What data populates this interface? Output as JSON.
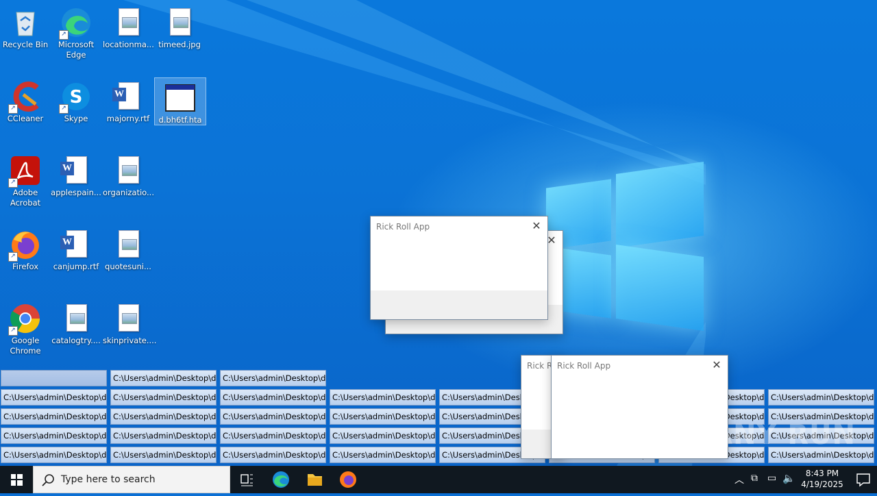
{
  "desktop": {
    "icons": [
      {
        "label": "Recycle Bin",
        "icon": "recycle-bin-icon"
      },
      {
        "label": "Microsoft Edge",
        "icon": "edge-icon"
      },
      {
        "label": "locationma...",
        "icon": "image-file-icon"
      },
      {
        "label": "timeed.jpg",
        "icon": "image-file-icon"
      },
      {
        "label": "CCleaner",
        "icon": "ccleaner-icon"
      },
      {
        "label": "Skype",
        "icon": "skype-icon"
      },
      {
        "label": "majorny.rtf",
        "icon": "word-doc-icon"
      },
      {
        "label": "d.bh6tf.hta",
        "icon": "hta-window-icon"
      },
      {
        "label": "Adobe Acrobat",
        "icon": "acrobat-icon"
      },
      {
        "label": "applespain...",
        "icon": "word-doc-icon"
      },
      {
        "label": "organizatio...",
        "icon": "image-file-icon"
      },
      {
        "label": "Firefox",
        "icon": "firefox-icon"
      },
      {
        "label": "canjump.rtf",
        "icon": "word-doc-icon"
      },
      {
        "label": "quotesuni...",
        "icon": "image-file-icon"
      },
      {
        "label": "Google Chrome",
        "icon": "chrome-icon"
      },
      {
        "label": "catalogtry....",
        "icon": "image-file-icon"
      },
      {
        "label": "skinprivate....",
        "icon": "image-file-icon"
      }
    ],
    "minimized_label": "C:\\Users\\admin\\Desktop\\d..."
  },
  "popups": [
    {
      "title": "Rick Roll App"
    },
    {
      "title": "Rick Roll App"
    },
    {
      "title": "Rick Ro"
    }
  ],
  "taskbar": {
    "search_placeholder": "Type here to search",
    "time": "8:43 PM",
    "date": "4/19/2025"
  },
  "watermark": "ANY RUN"
}
